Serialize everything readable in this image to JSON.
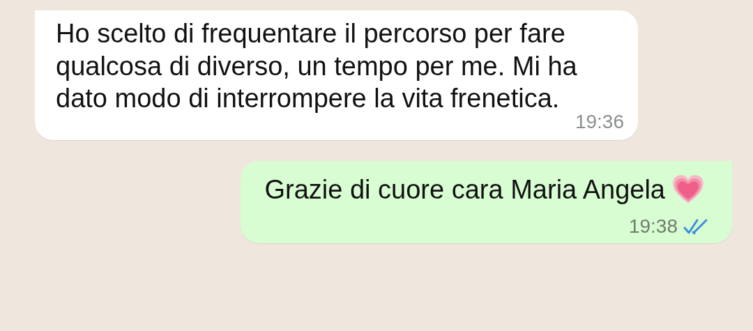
{
  "messages": [
    {
      "kind": "incoming",
      "text": "Ho scelto di frequentare il percorso per fare qualcosa di diverso, un tempo per me. Mi ha dato modo di interrompere la vita frenetica.",
      "time": "19:36"
    },
    {
      "kind": "outgoing",
      "text": "Grazie di cuore cara Maria Angela",
      "heart_emoji": true,
      "time": "19:38",
      "read": true
    }
  ]
}
